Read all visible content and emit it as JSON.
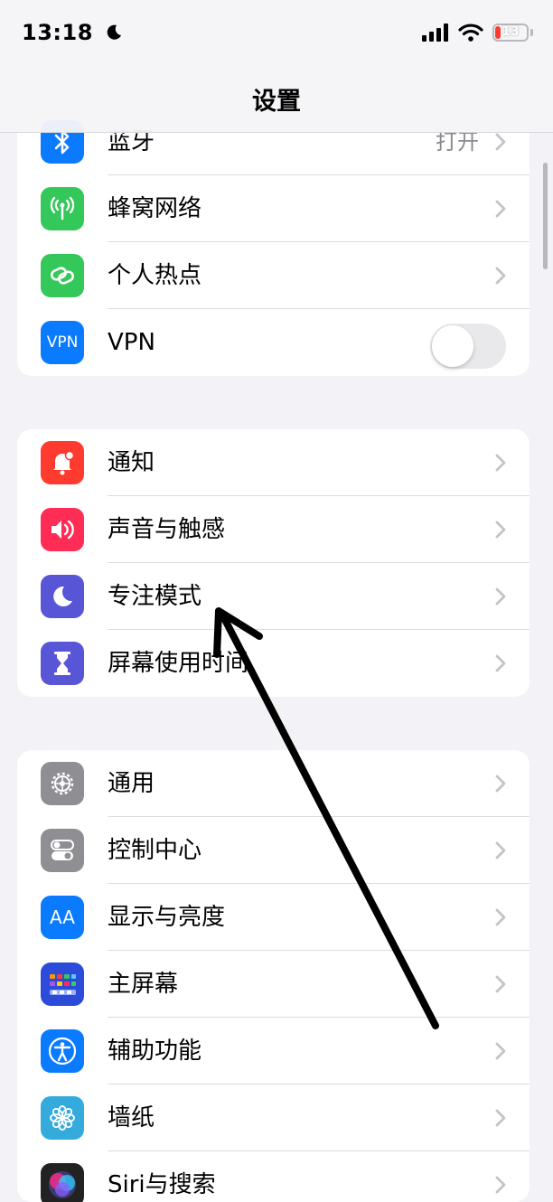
{
  "status_bar": {
    "time": "13:18",
    "battery_level": "13",
    "focus_icon": "moon-icon",
    "signal_icon": "cellular-signal-icon",
    "wifi_icon": "wifi-icon"
  },
  "nav": {
    "title": "设置"
  },
  "groups": [
    {
      "rows": [
        {
          "label": "蓝牙",
          "value": "打开",
          "icon": "bluetooth-icon",
          "color": "#0a7aff"
        },
        {
          "label": "蜂窝网络",
          "icon": "antenna-icon",
          "color": "#34c759"
        },
        {
          "label": "个人热点",
          "icon": "link-icon",
          "color": "#34c759"
        },
        {
          "label": "VPN",
          "icon_text": "VPN",
          "icon": "vpn-icon",
          "color": "#0a7aff",
          "toggle_on": false
        }
      ]
    },
    {
      "rows": [
        {
          "label": "通知",
          "icon": "bell-icon",
          "color": "#ff3b30"
        },
        {
          "label": "声音与触感",
          "icon": "speaker-icon",
          "color": "#ff2d55"
        },
        {
          "label": "专注模式",
          "icon": "moon-icon",
          "color": "#5856d6"
        },
        {
          "label": "屏幕使用时间",
          "icon": "hourglass-icon",
          "color": "#5856d6"
        }
      ]
    },
    {
      "rows": [
        {
          "label": "通用",
          "icon": "gear-icon",
          "color": "#8e8e93"
        },
        {
          "label": "控制中心",
          "icon": "switches-icon",
          "color": "#8e8e93"
        },
        {
          "label": "显示与亮度",
          "icon_text": "AA",
          "icon": "text-size-icon",
          "color": "#0a7aff"
        },
        {
          "label": "主屏幕",
          "icon": "app-grid-icon",
          "color": "#2c4bd8"
        },
        {
          "label": "辅助功能",
          "icon": "accessibility-icon",
          "color": "#0a7aff"
        },
        {
          "label": "墙纸",
          "icon": "flower-icon",
          "color": "#35aadc"
        },
        {
          "label": "Siri与搜索",
          "icon": "siri-icon",
          "color": "#222222"
        }
      ]
    }
  ],
  "annotation": {
    "icon": "hand-drawn-arrow-icon",
    "color": "#000000"
  }
}
